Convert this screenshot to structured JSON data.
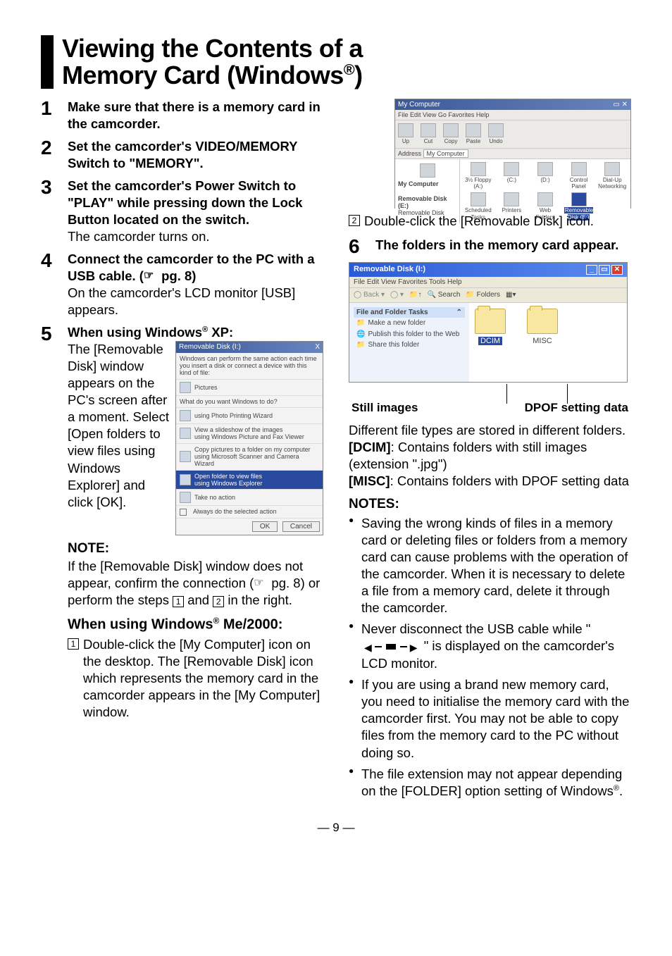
{
  "title_line1": "Viewing the Contents of a",
  "title_line2_a": "Memory Card (Windows",
  "title_line2_b": ")",
  "steps": {
    "s1": {
      "num": "1",
      "head": "Make sure that there is a memory card in the camcorder."
    },
    "s2": {
      "num": "2",
      "head": "Set the camcorder's VIDEO/MEMORY Switch to \"MEMORY\"."
    },
    "s3": {
      "num": "3",
      "head": "Set the camcorder's Power Switch to \"PLAY\" while pressing down the Lock Button located on the switch.",
      "body": "The camcorder turns on."
    },
    "s4": {
      "num": "4",
      "head_a": "Connect the camcorder to the PC with a USB cable. (",
      "head_b": " pg. 8)",
      "body": "On the camcorder's LCD monitor [USB] appears."
    },
    "s5": {
      "num": "5",
      "head_a": "When using Windows",
      "head_b": " XP:",
      "body": "The [Removable Disk] window appears on the PC's screen after a moment. Select [Open folders to view files using Windows Explorer] and click [OK]."
    },
    "s6": {
      "num": "6",
      "head": "The folders in the memory card appear."
    }
  },
  "note_h": "NOTE:",
  "note_body_a": "If the [Removable Disk] window does not appear, confirm the connection (",
  "note_body_b": " pg. 8) or perform the steps ",
  "note_body_c": " and ",
  "note_body_d": " in the right.",
  "sq1": "1",
  "sq2": "2",
  "sub_h_a": "When using Windows",
  "sub_h_b": " Me/2000:",
  "sub1_sq": "1",
  "sub1": "Double-click the [My Computer] icon on the desktop. The [Removable Disk] icon which represents the memory card in the camcorder appears in the [My Computer] window.",
  "sub2_sq": "2",
  "sub2": "Double-click the [Removable Disk] icon.",
  "callout_left": "Still images",
  "callout_right": "DPOF setting data",
  "desc1": "Different file types are stored in different folders.",
  "desc2a": "[DCIM]",
  "desc2b": ": Contains folders with still images (extension \".jpg\")",
  "desc3a": "[MISC]",
  "desc3b": ": Contains folders with DPOF setting data",
  "notes_h": "NOTES:",
  "bullets": {
    "b1": "Saving the wrong kinds of files in a memory card or deleting files or folders from a memory card can cause problems with the operation of the camcorder. When it is necessary to delete a file from a memory card, delete it through the camcorder.",
    "b2a": "Never disconnect the USB cable while \" ",
    "b2b": " \" is displayed on the camcorder's LCD monitor.",
    "b3": "If you are using a brand new memory card, you need to initialise the memory card with the camcorder first. You may not be able to copy files from the memory card to the PC without doing so.",
    "b4a": "The file extension may not appear depending on the [FOLDER] option setting of Windows",
    "b4b": "."
  },
  "pgnum": "— 9 —",
  "inset_autoplay": {
    "title": "Removable Disk (I:)",
    "close": "X",
    "prompt": "Windows can perform the same action each time you insert a disk or connect a device with this kind of file:",
    "kind": "Pictures",
    "q": "What do you want Windows to do?",
    "o1": "using Photo Printing Wizard",
    "o2a": "View a slideshow of the images",
    "o2b": "using Windows Picture and Fax Viewer",
    "o3a": "Copy pictures to a folder on my computer",
    "o3b": "using Microsoft Scanner and Camera Wizard",
    "o4a": "Open folder to view files",
    "o4b": "using Windows Explorer",
    "o5": "Take no action",
    "chk": "Always do the selected action",
    "ok": "OK",
    "cancel": "Cancel"
  },
  "inset_mc": {
    "title": "My Computer",
    "menu": "File   Edit   View   Go   Favorites   Help",
    "tb": {
      "up": "Up",
      "cut": "Cut",
      "copy": "Copy",
      "paste": "Paste",
      "undo": "Undo"
    },
    "addr": "Address",
    "addr_v": "My Computer",
    "left_h": "My Computer",
    "left_a": "Removable Disk (E:)",
    "left_b": "Removable Disk",
    "icons": {
      "a": "3½ Floppy (A:)",
      "c": "(C:)",
      "d": "(D:)",
      "cp": "Control Panel",
      "du": "Dial-Up Networking",
      "st": "Scheduled Tasks",
      "pr": "Printers",
      "wf": "Web Folders",
      "rd": "Removable Disk (E:)"
    }
  },
  "inset_ex": {
    "title": "Removable Disk (I:)",
    "menu": "File   Edit   View   Favorites   Tools   Help",
    "tb": {
      "back": "Back",
      "search": "Search",
      "folders": "Folders"
    },
    "task_h": "File and Folder Tasks",
    "t1": "Make a new folder",
    "t2": "Publish this folder to the Web",
    "t3": "Share this folder",
    "f1": "DCIM",
    "f2": "MISC"
  }
}
